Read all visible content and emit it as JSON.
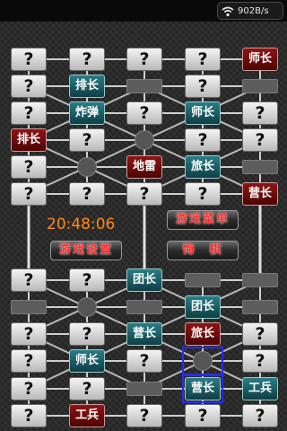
{
  "status_bar": {
    "speed": "902B/s",
    "wifi_icon": "wifi-icon"
  },
  "timer": "20:48:06",
  "buttons": {
    "game_menu": "游戏菜单",
    "game_settings": "游戏设置",
    "surrender": "悔　棋"
  },
  "colors": {
    "red_piece": "#6b0a0a",
    "teal_piece": "#1c5c64",
    "hidden_piece": "#dcdcdc",
    "timer": "#ff8a12",
    "menu_text": "#ff2a2a",
    "selection": "#2a2aff"
  },
  "board": {
    "rows": [
      [
        "?",
        "?",
        "?",
        "?",
        "师长"
      ],
      [
        "?",
        "排长",
        "·",
        "?",
        "·"
      ],
      [
        "?",
        "炸弹",
        "?",
        "师长",
        "?"
      ],
      [
        "排长",
        "?",
        "o",
        "?",
        "?"
      ],
      [
        "?",
        "o",
        "地雷",
        "旅长",
        "·"
      ],
      [
        "?",
        "?",
        "?",
        "?",
        "营长"
      ],
      [
        "?",
        "?",
        "团长",
        "·",
        "·"
      ],
      [
        "·",
        "o",
        "·",
        "团长",
        "·"
      ],
      [
        "?",
        "?",
        "营长",
        "旅长",
        "?"
      ],
      [
        "?",
        "师长",
        "?",
        "o",
        "?"
      ],
      [
        "?",
        "?",
        "·",
        "营长",
        "工兵"
      ],
      [
        "?",
        "工兵",
        "?",
        "?",
        "?"
      ]
    ],
    "piece_types": {
      "师长_top": "red",
      "排长": "teal",
      "炸弹": "teal",
      "师长": "teal",
      "地雷": "red",
      "旅长": "teal",
      "营长": "red",
      "团长": "teal",
      "工兵": "red"
    },
    "red_pieces": [
      "0-4",
      "3-0",
      "4-2",
      "5-4",
      "8-3",
      "11-1"
    ],
    "selected": [
      "9-3",
      "10-3"
    ]
  }
}
